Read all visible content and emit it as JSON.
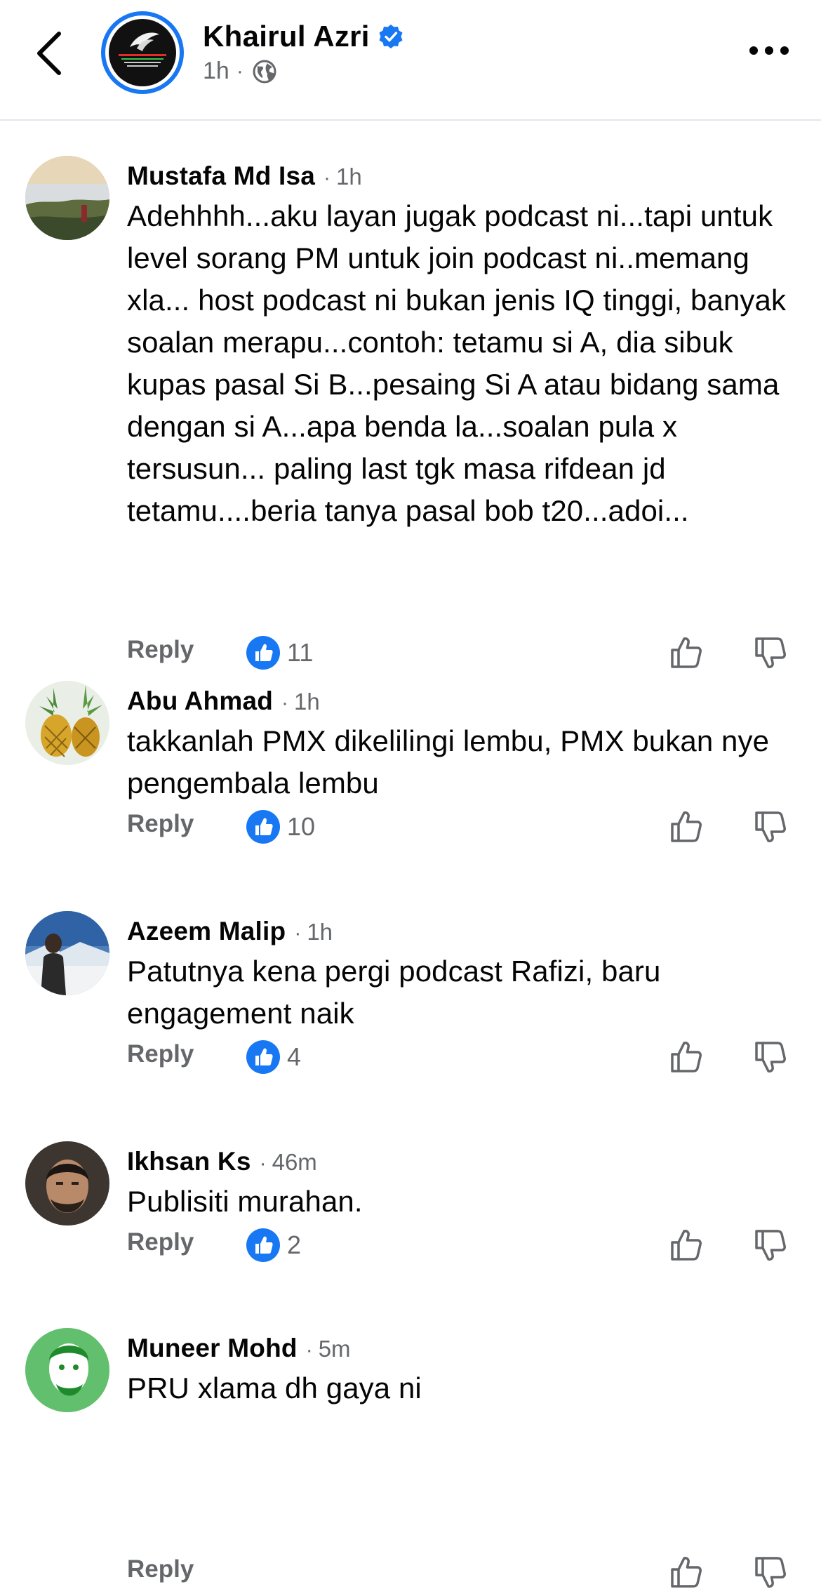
{
  "header": {
    "page_name": "Khairul Azri",
    "time": "1h",
    "dot": "·",
    "icons": {
      "back": "chevron-left-icon",
      "verified": "verified-badge-icon",
      "audience": "globe-icon",
      "more": "more-horizontal-icon"
    }
  },
  "colors": {
    "accent": "#1877f2",
    "secondary_text": "#65676b",
    "text": "#050505",
    "divider": "#e4e6eb"
  },
  "comments": [
    {
      "author": "Mustafa Md Isa",
      "time": "1h",
      "text": "Adehhhh...aku layan jugak podcast ni...tapi untuk level sorang PM untuk join podcast ni..memang xla... host podcast ni bukan jenis IQ tinggi, banyak soalan merapu...contoh: tetamu si A, dia sibuk kupas pasal Si B...pesaing Si A atau bidang sama dengan si A...apa benda la...soalan pula x tersusun... paling last tgk masa rifdean jd tetamu....beria tanya pasal bob t20...adoi...",
      "reply_label": "Reply",
      "likes": "11"
    },
    {
      "author": "Abu Ahmad",
      "time": "1h",
      "text": "takkanlah PMX dikelilingi lembu, PMX bukan nye pengembala lembu",
      "reply_label": "Reply",
      "likes": "10"
    },
    {
      "author": "Azeem Malip",
      "time": "1h",
      "text": "Patutnya kena pergi podcast Rafizi, baru engagement naik",
      "reply_label": "Reply",
      "likes": "4"
    },
    {
      "author": "Ikhsan Ks",
      "time": "46m",
      "text": "Publisiti murahan.",
      "reply_label": "Reply",
      "likes": "2"
    },
    {
      "author": "Muneer Mohd",
      "time": "5m",
      "text": "PRU xlama dh gaya ni",
      "reply_label": "Reply",
      "likes": ""
    }
  ]
}
